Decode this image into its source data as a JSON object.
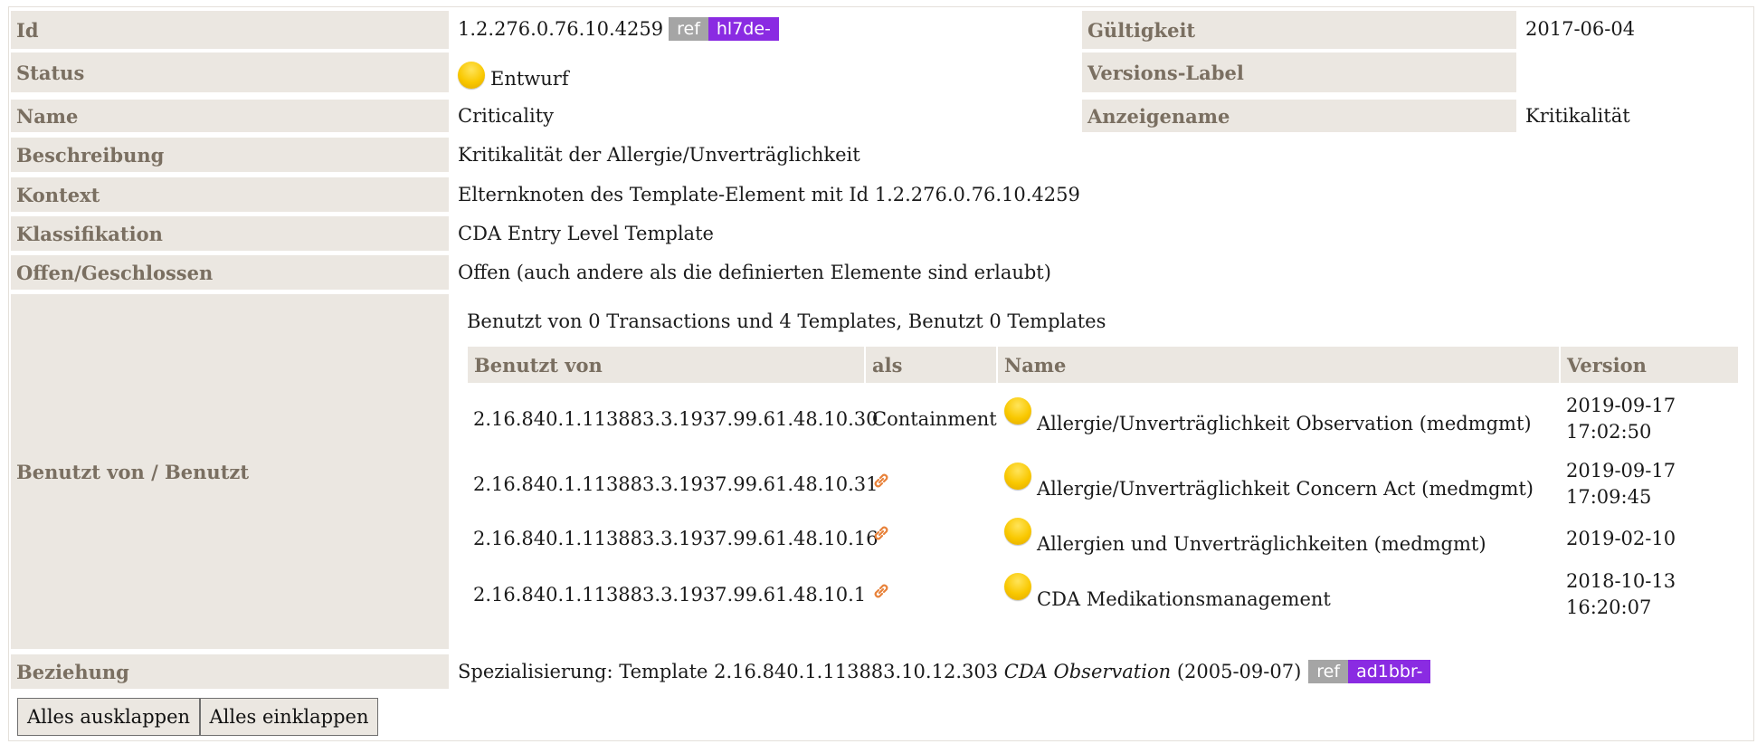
{
  "fields": {
    "id_label": "Id",
    "id_value": "1.2.276.0.76.10.4259",
    "id_ref": "ref",
    "id_ref_code": "hl7de-",
    "gueltigkeit_label": "Gültigkeit",
    "gueltigkeit_value": "2017-06-04",
    "status_label": "Status",
    "status_value": "Entwurf",
    "versions_label_label": "Versions-Label",
    "versions_label_value": "",
    "name_label": "Name",
    "name_value": "Criticality",
    "anzeigename_label": "Anzeigename",
    "anzeigename_value": "Kritikalität",
    "beschreibung_label": "Beschreibung",
    "beschreibung_value": "Kritikalität der Allergie/Unverträglichkeit",
    "kontext_label": "Kontext",
    "kontext_value": "Elternknoten des Template-Element mit Id 1.2.276.0.76.10.4259",
    "klassifikation_label": "Klassifikation",
    "klassifikation_value": "CDA Entry Level Template",
    "offen_label": "Offen/Geschlossen",
    "offen_value": "Offen (auch andere als die definierten Elemente sind erlaubt)",
    "benutzt_label": "Benutzt von / Benutzt",
    "beziehung_label": "Beziehung"
  },
  "usage": {
    "summary": "Benutzt von 0 Transactions und 4 Templates, Benutzt 0 Templates",
    "headers": {
      "used_by": "Benutzt von",
      "as": "als",
      "name": "Name",
      "version": "Version"
    },
    "rows": [
      {
        "oid": "2.16.840.1.113883.3.1937.99.61.48.10.30",
        "as": "Containment",
        "as_icon": "",
        "name": "Allergie/Unverträglichkeit Observation (medmgmt)",
        "version_date": "2019-09-17",
        "version_time": "17:02:50"
      },
      {
        "oid": "2.16.840.1.113883.3.1937.99.61.48.10.31",
        "as": "",
        "as_icon": "link-icon",
        "name": "Allergie/Unverträglichkeit Concern Act (medmgmt)",
        "version_date": "2019-09-17",
        "version_time": "17:09:45"
      },
      {
        "oid": "2.16.840.1.113883.3.1937.99.61.48.10.16",
        "as": "",
        "as_icon": "link-icon",
        "name": "Allergien und Unverträglichkeiten (medmgmt)",
        "version_date": "2019-02-10",
        "version_time": ""
      },
      {
        "oid": "2.16.840.1.113883.3.1937.99.61.48.10.1",
        "as": "",
        "as_icon": "link-icon",
        "name": "CDA Medikationsmanagement",
        "version_date": "2018-10-13",
        "version_time": "16:20:07"
      }
    ]
  },
  "relation": {
    "prefix": "Spezialisierung: Template 2.16.840.1.113883.10.12.303",
    "template_name": "CDA Observation",
    "date": "(2005-09-07)",
    "ref": "ref",
    "ref_code": "ad1bbr-"
  },
  "buttons": {
    "expand_all": "Alles ausklappen",
    "collapse_all": "Alles einklappen"
  },
  "colors": {
    "label_bg": "#ebe7e1",
    "label_text": "#7a6f61",
    "ref_badge": "#a5a5a5",
    "project_badge": "#8a2be2",
    "status_draft": "#f9c800",
    "link_icon": "#e8823a"
  },
  "icons": {
    "status": "status-draft-icon",
    "link": "link-icon"
  }
}
